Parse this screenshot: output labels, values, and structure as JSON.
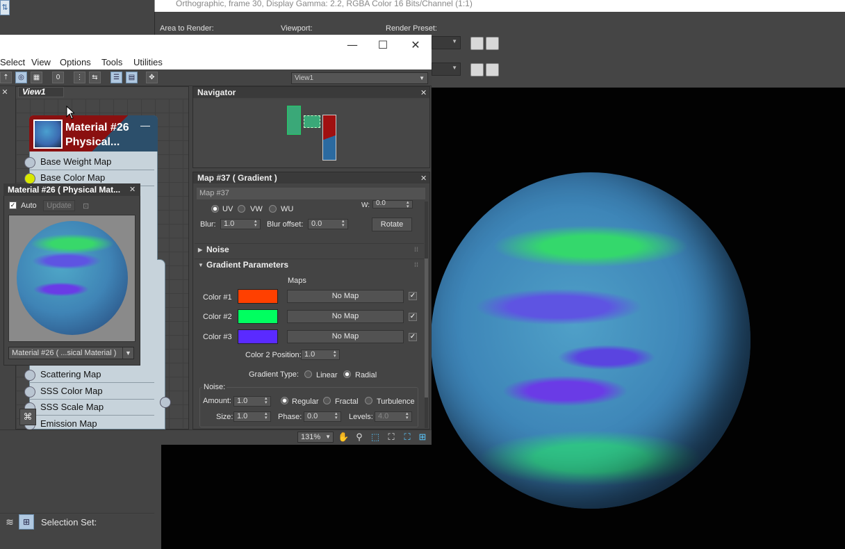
{
  "render_window": {
    "title": "Orthographic, frame 30, Display Gamma: 2.2, RGBA Color 16 Bits/Channel (1:1)",
    "area_label": "Area to Render:",
    "viewport_label": "Viewport:",
    "preset_label": "Render Preset:"
  },
  "sme": {
    "menu": [
      "Select",
      "View",
      "Options",
      "Tools",
      "Utilities"
    ],
    "view_select": "View1",
    "view_tab": "View1"
  },
  "node": {
    "title": "Material #26 Physical...",
    "slots": [
      "Base Weight Map",
      "Base Color Map",
      "Scattering Map",
      "SSS Color Map",
      "SSS Scale Map",
      "Emission Map"
    ]
  },
  "preview": {
    "title": "Material #26  ( Physical Mat...",
    "auto_label": "Auto",
    "update_label": "Update",
    "dropdown": "Material #26  ( ...sical Material )"
  },
  "navigator": {
    "title": "Navigator"
  },
  "map": {
    "title": "Map #37  ( Gradient )",
    "name": "Map #37",
    "coords": {
      "uv": "UV",
      "vw": "VW",
      "wu": "WU",
      "w_label": "W:",
      "w_value": "0.0"
    },
    "blur_label": "Blur:",
    "blur": "1.0",
    "blur_offset_label": "Blur offset:",
    "blur_offset": "0.0",
    "rotate_label": "Rotate",
    "noise_rollout": "Noise",
    "gradient_rollout": "Gradient Parameters",
    "maps_label": "Maps",
    "colors": [
      {
        "label": "Color #1",
        "hex": "#ff4000",
        "map": "No Map"
      },
      {
        "label": "Color #2",
        "hex": "#00ff60",
        "map": "No Map"
      },
      {
        "label": "Color #3",
        "hex": "#5a2aff",
        "map": "No Map"
      }
    ],
    "color2_position_label": "Color 2 Position:",
    "color2_position": "1.0",
    "gradient_type_label": "Gradient Type:",
    "linear_label": "Linear",
    "radial_label": "Radial",
    "noise_group_label": "Noise:",
    "amount_label": "Amount:",
    "amount": "1.0",
    "regular_label": "Regular",
    "fractal_label": "Fractal",
    "turbulence_label": "Turbulence",
    "size_label": "Size:",
    "size": "1.0",
    "phase_label": "Phase:",
    "phase": "0.0",
    "levels_label": "Levels:",
    "levels": "4.0"
  },
  "status": {
    "zoom": "131%"
  },
  "bottom": {
    "selection_set": "Selection Set:"
  }
}
